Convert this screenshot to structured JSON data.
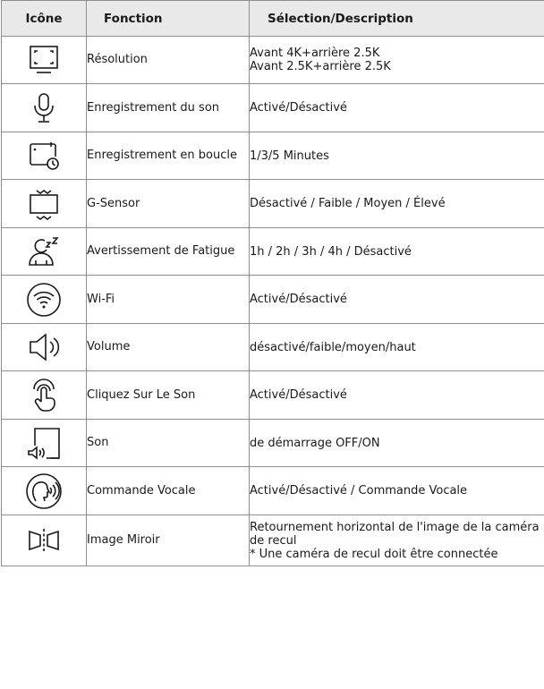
{
  "table": {
    "headers": [
      "Icône",
      "Fonction",
      "Sélection/Description"
    ],
    "rows": [
      {
        "icon": "resolution-icon",
        "function": "Résolution",
        "description": [
          "Avant 4K+arrière 2.5K",
          "Avant 2.5K+arrière 2.5K"
        ]
      },
      {
        "icon": "microphone-icon",
        "function": "Enregistrement du son",
        "description": [
          "Activé/Désactivé"
        ]
      },
      {
        "icon": "loop-recording-icon",
        "function": "Enregistrement en boucle",
        "description": [
          "1/3/5 Minutes"
        ]
      },
      {
        "icon": "g-sensor-icon",
        "function": "G-Sensor",
        "description": [
          "Désactivé / Faible / Moyen / Élevé"
        ]
      },
      {
        "icon": "fatigue-icon",
        "function": "Avertissement de Fatigue",
        "description": [
          "1h / 2h / 3h / 4h / Désactivé"
        ]
      },
      {
        "icon": "wifi-icon",
        "function": "Wi-Fi",
        "description": [
          "Activé/Désactivé"
        ]
      },
      {
        "icon": "volume-icon",
        "function": "Volume",
        "description": [
          "désactivé/faible/moyen/haut"
        ]
      },
      {
        "icon": "click-sound-icon",
        "function": "Cliquez Sur Le Son",
        "description": [
          "Activé/Désactivé"
        ]
      },
      {
        "icon": "startup-sound-icon",
        "function": "Son",
        "description": [
          "de démarrage OFF/ON"
        ]
      },
      {
        "icon": "voice-command-icon",
        "function": "Commande Vocale",
        "description": [
          "Activé/Désactivé / Commande Vocale"
        ]
      },
      {
        "icon": "mirror-image-icon",
        "function": "Image Miroir",
        "description": [
          "Retournement horizontal de l'image de la caméra de recul",
          "* Une caméra de recul doit être connectée"
        ]
      }
    ]
  }
}
